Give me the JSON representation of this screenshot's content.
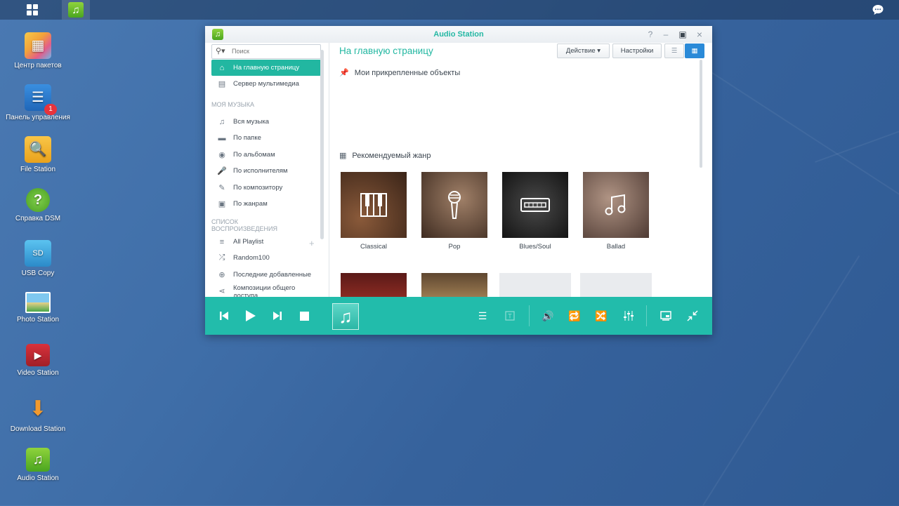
{
  "taskbar": {
    "apps_icon": "grid-icon",
    "audio_icon": "music-note-icon",
    "chat_icon": "chat-bubble-icon"
  },
  "desktop": [
    {
      "label": "Центр пакетов",
      "icon": "package-center-icon"
    },
    {
      "label": "Панель управления",
      "icon": "control-panel-icon",
      "badge": "1"
    },
    {
      "label": "File Station",
      "icon": "folder-search-icon"
    },
    {
      "label": "Справка DSM",
      "icon": "help-icon"
    },
    {
      "label": "USB Copy",
      "icon": "usb-copy-icon"
    },
    {
      "label": "Photo Station",
      "icon": "photo-icon"
    },
    {
      "label": "Video Station",
      "icon": "video-icon"
    },
    {
      "label": "Download Station",
      "icon": "download-icon"
    },
    {
      "label": "Audio Station",
      "icon": "music-note-icon"
    }
  ],
  "window": {
    "title": "Audio Station",
    "controls": {
      "help": "?",
      "minimize": "–",
      "maximize": "▣",
      "close": "×"
    }
  },
  "sidebar": {
    "search_placeholder": "Поиск",
    "top_items": [
      {
        "label": "На главную страницу",
        "icon": "home-icon",
        "active": true
      },
      {
        "label": "Сервер мультимедиа",
        "icon": "media-server-icon"
      }
    ],
    "my_music_title": "МОЯ МУЗЫКА",
    "my_music": [
      {
        "label": "Вся музыка",
        "icon": "music-note-icon"
      },
      {
        "label": "По папке",
        "icon": "folder-icon"
      },
      {
        "label": "По альбомам",
        "icon": "album-icon"
      },
      {
        "label": "По исполнителям",
        "icon": "microphone-icon"
      },
      {
        "label": "По композитору",
        "icon": "pen-icon"
      },
      {
        "label": "По жанрам",
        "icon": "genre-icon"
      }
    ],
    "playlist_title_1": "СПИСОК",
    "playlist_title_2": "ВОСПРОИЗВЕДЕНИЯ",
    "playlist_add": "+",
    "playlists": [
      {
        "label": "All Playlist",
        "icon": "playlist-icon"
      },
      {
        "label": "Random100",
        "icon": "shuffle-icon"
      },
      {
        "label": "Последние добавленные",
        "icon": "add-circle-icon"
      },
      {
        "label": "Композиции общего доступа",
        "icon": "share-icon"
      }
    ]
  },
  "main": {
    "title": "На главную страницу",
    "action_button": "Действие ▾",
    "settings_button": "Настройки",
    "pinned_title": "Мои прикрепленные объекты",
    "genre_title": "Рекомендуемый жанр",
    "genres": [
      {
        "label": "Classical",
        "icon": "piano-icon",
        "bg": "#5a3a2a"
      },
      {
        "label": "Pop",
        "icon": "microphone-icon",
        "bg": "#6b5040"
      },
      {
        "label": "Blues/Soul",
        "icon": "harmonica-icon",
        "bg": "#2c2c2c"
      },
      {
        "label": "Ballad",
        "icon": "music-note-icon",
        "bg": "#7a6258"
      }
    ]
  },
  "player": {
    "prev": "prev-icon",
    "play": "play-icon",
    "next": "next-icon",
    "stop": "stop-icon",
    "cover": "music-note-icon",
    "right_icons": [
      "playlist-icon",
      "lyrics-icon",
      "volume-icon",
      "repeat-icon",
      "shuffle-icon",
      "equalizer-icon",
      "mini-player-icon",
      "collapse-icon"
    ]
  }
}
